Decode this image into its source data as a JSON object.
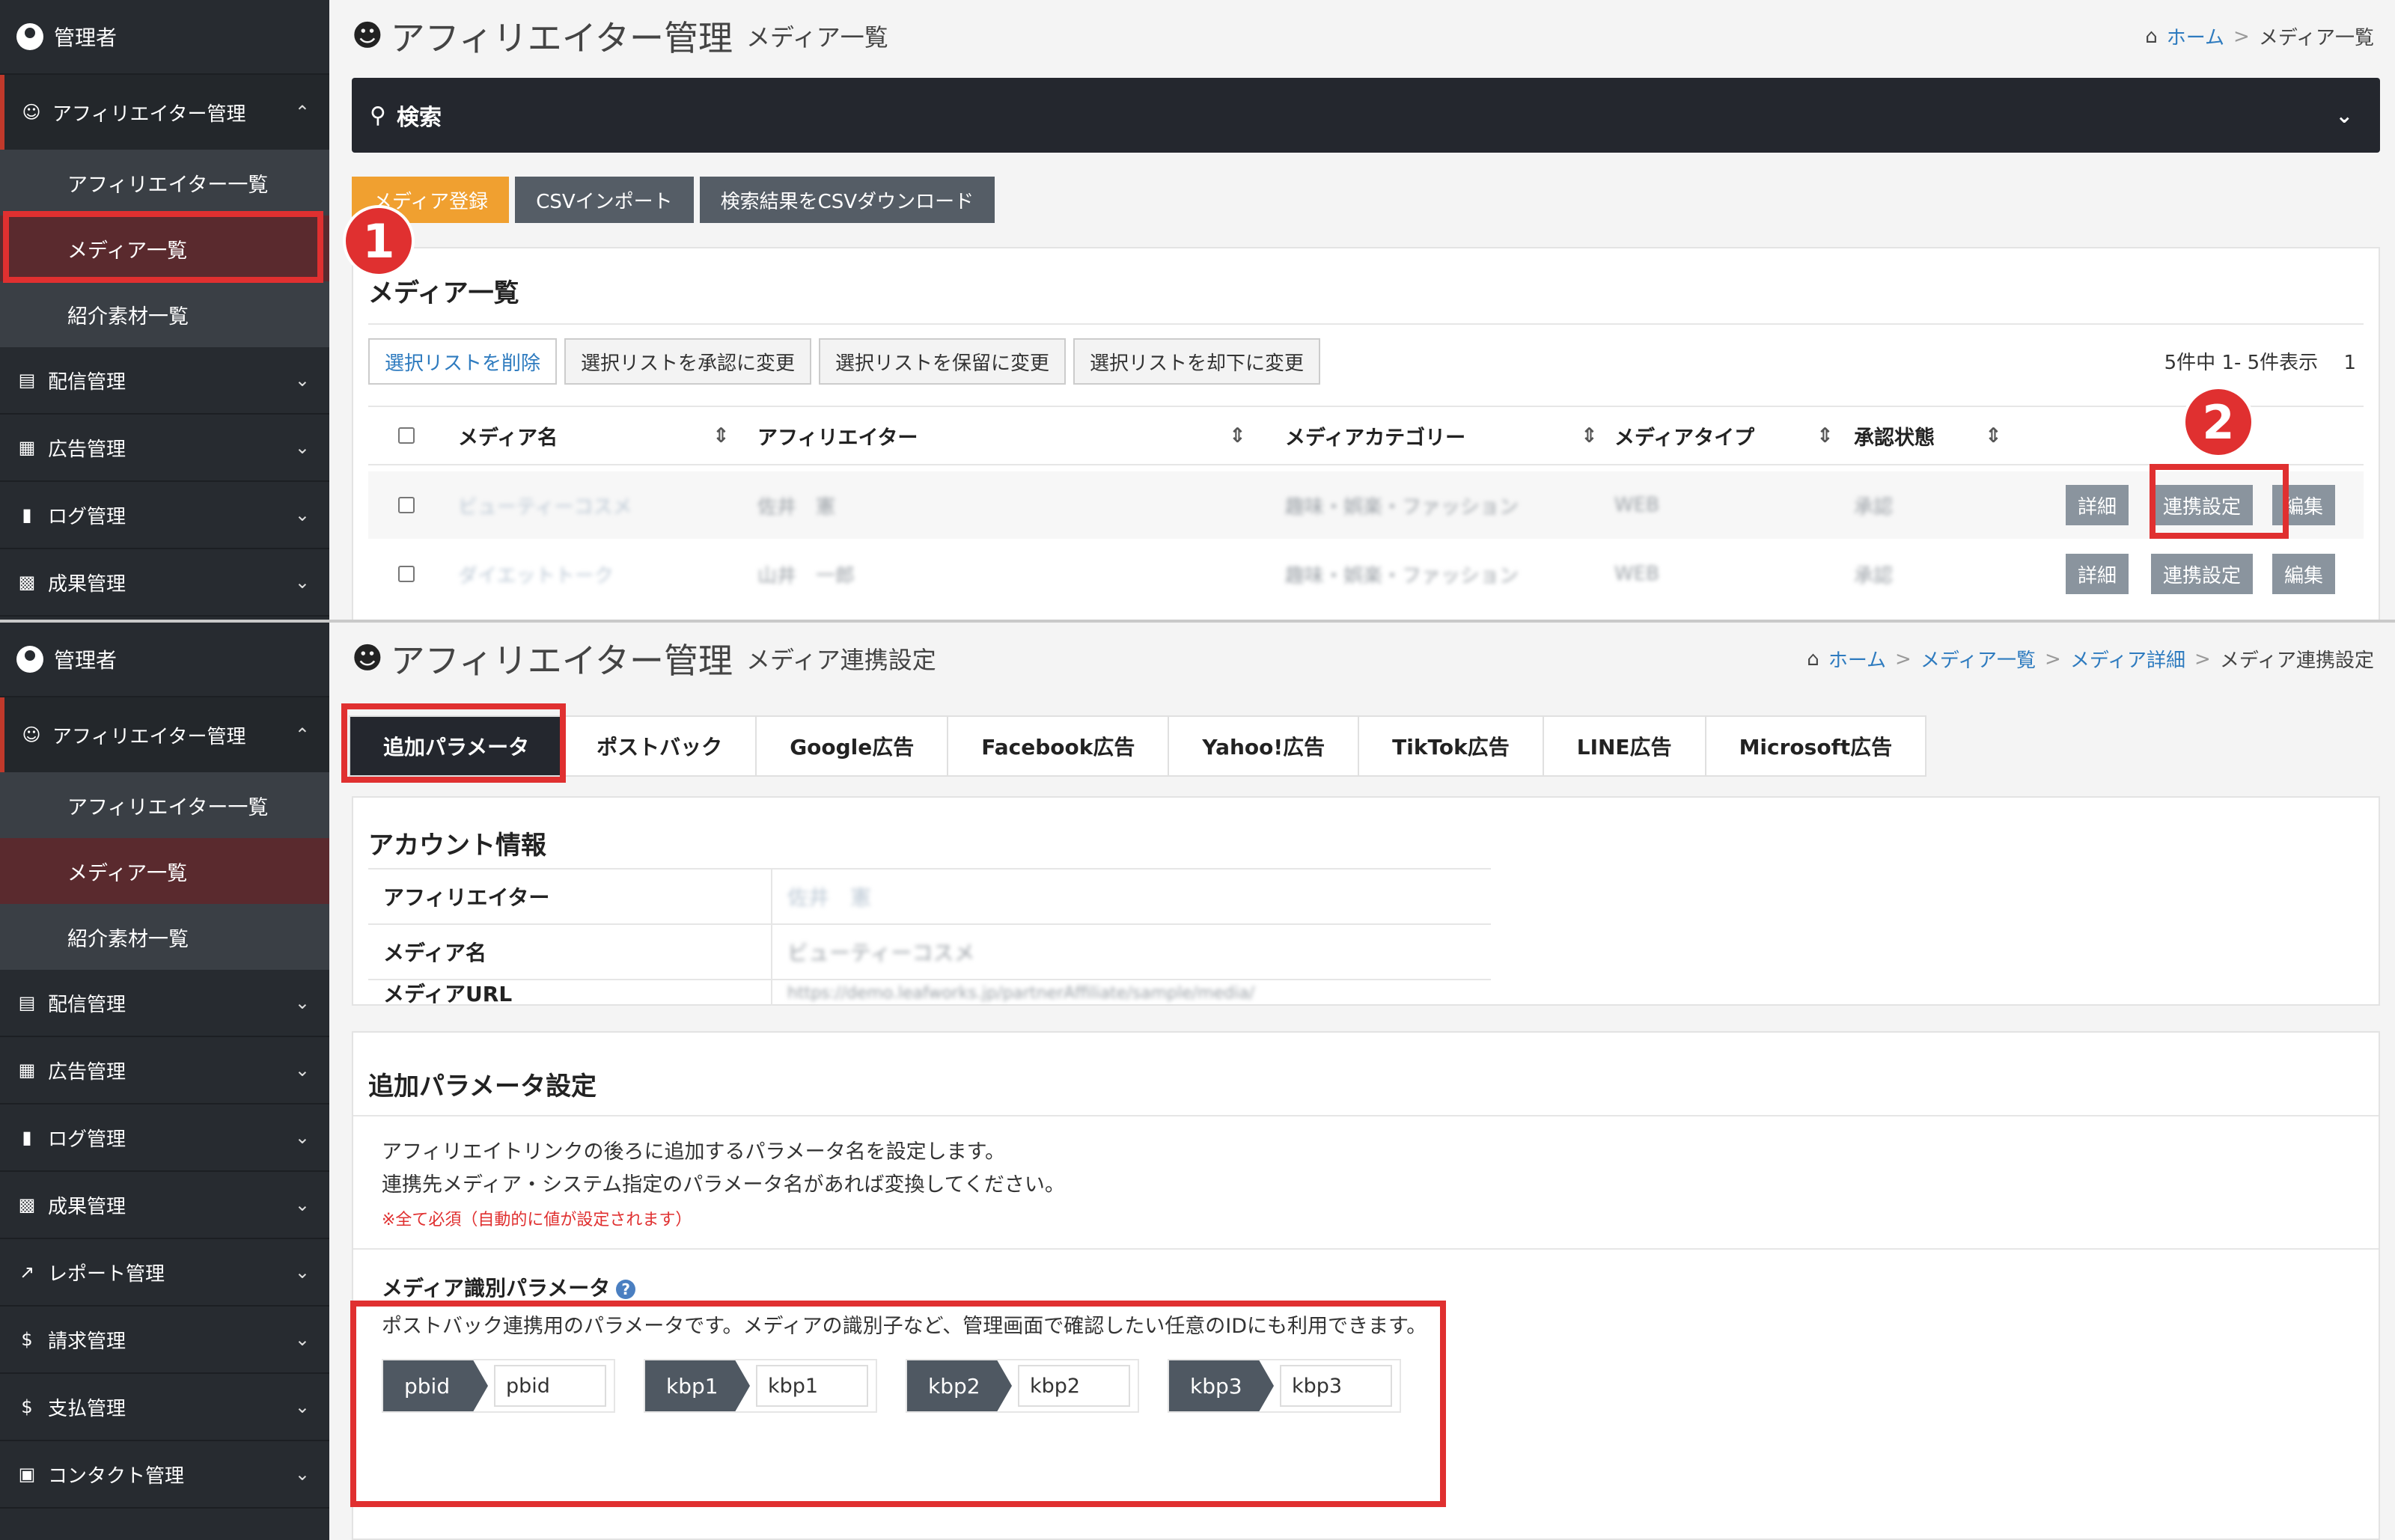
{
  "colors": {
    "sidebar_bg": "#272b30",
    "accent_red": "#e03030",
    "orange": "#f0a030",
    "dark_btn": "#555d66",
    "link": "#2e7bbf"
  },
  "sidebar": {
    "admin": "管理者",
    "group": "アフィリエイター管理",
    "sub_items": [
      "アフィリエイター一覧",
      "メディア一覧",
      "紹介素材一覧"
    ],
    "items_a": [
      "配信管理",
      "広告管理",
      "ログ管理",
      "成果管理"
    ],
    "items_b": [
      "配信管理",
      "広告管理",
      "ログ管理",
      "成果管理",
      "レポート管理",
      "請求管理",
      "支払管理",
      "コンタクト管理"
    ]
  },
  "shotA": {
    "title": "アフィリエイター管理",
    "subtitle": "メディア一覧",
    "breadcrumb": {
      "home": "ホーム",
      "current": "メディア一覧"
    },
    "search_label": "検索",
    "buttons": [
      "メディア登録",
      "CSVインポート",
      "検索結果をCSVダウンロード"
    ],
    "panel_title": "メディア一覧",
    "list_buttons": [
      "選択リストを削除",
      "選択リストを承認に変更",
      "選択リストを保留に変更",
      "選択リストを却下に変更"
    ],
    "pager": "5件中 1- 5件表示　 1",
    "columns": [
      "メディア名",
      "アフィリエイター",
      "メディアカテゴリー",
      "メディアタイプ",
      "承認状態"
    ],
    "rows": [
      {
        "name": "ビューティーコスメ",
        "affiliate": "佐井　憲",
        "category": "趣味・娯楽・ファッション",
        "type": "WEB",
        "status": "承認"
      },
      {
        "name": "ダイエットトーク",
        "affiliate": "山井　一郎",
        "category": "趣味・娯楽・ファッション",
        "type": "WEB",
        "status": "承認"
      }
    ],
    "row_actions": [
      "詳細",
      "連携設定",
      "編集"
    ],
    "markers": [
      "1",
      "2"
    ]
  },
  "shotB": {
    "title": "アフィリエイター管理",
    "subtitle": "メディア連携設定",
    "breadcrumb": {
      "home": "ホーム",
      "media_list": "メディア一覧",
      "media_detail": "メディア詳細",
      "current": "メディア連携設定"
    },
    "tabs": [
      "追加パラメータ",
      "ポストバック",
      "Google広告",
      "Facebook広告",
      "Yahoo!広告",
      "TikTok広告",
      "LINE広告",
      "Microsoft広告"
    ],
    "account_title": "アカウント情報",
    "account": [
      {
        "label": "アフィリエイター",
        "value": "佐井　憲"
      },
      {
        "label": "メディア名",
        "value": "ビューティーコスメ"
      },
      {
        "label": "メディアURL",
        "value": "https://demo.leafworks.jp/partnerAffiliate/sample/media/"
      }
    ],
    "params_title": "追加パラメータ設定",
    "desc1": "アフィリエイトリンクの後ろに追加するパラメータ名を設定します。",
    "desc2": "連携先メディア・システム指定のパラメータ名があれば変換してください。",
    "required_note": "※全て必須（自動的に値が設定されます）",
    "media_param_title": "メディア識別パラメータ",
    "media_param_desc": "ポストバック連携用のパラメータです。メディアの識別子など、管理画面で確認したい任意のIDにも利用できます。",
    "params": [
      {
        "label": "pbid",
        "value": "pbid"
      },
      {
        "label": "kbp1",
        "value": "kbp1"
      },
      {
        "label": "kbp2",
        "value": "kbp2"
      },
      {
        "label": "kbp3",
        "value": "kbp3"
      }
    ]
  }
}
